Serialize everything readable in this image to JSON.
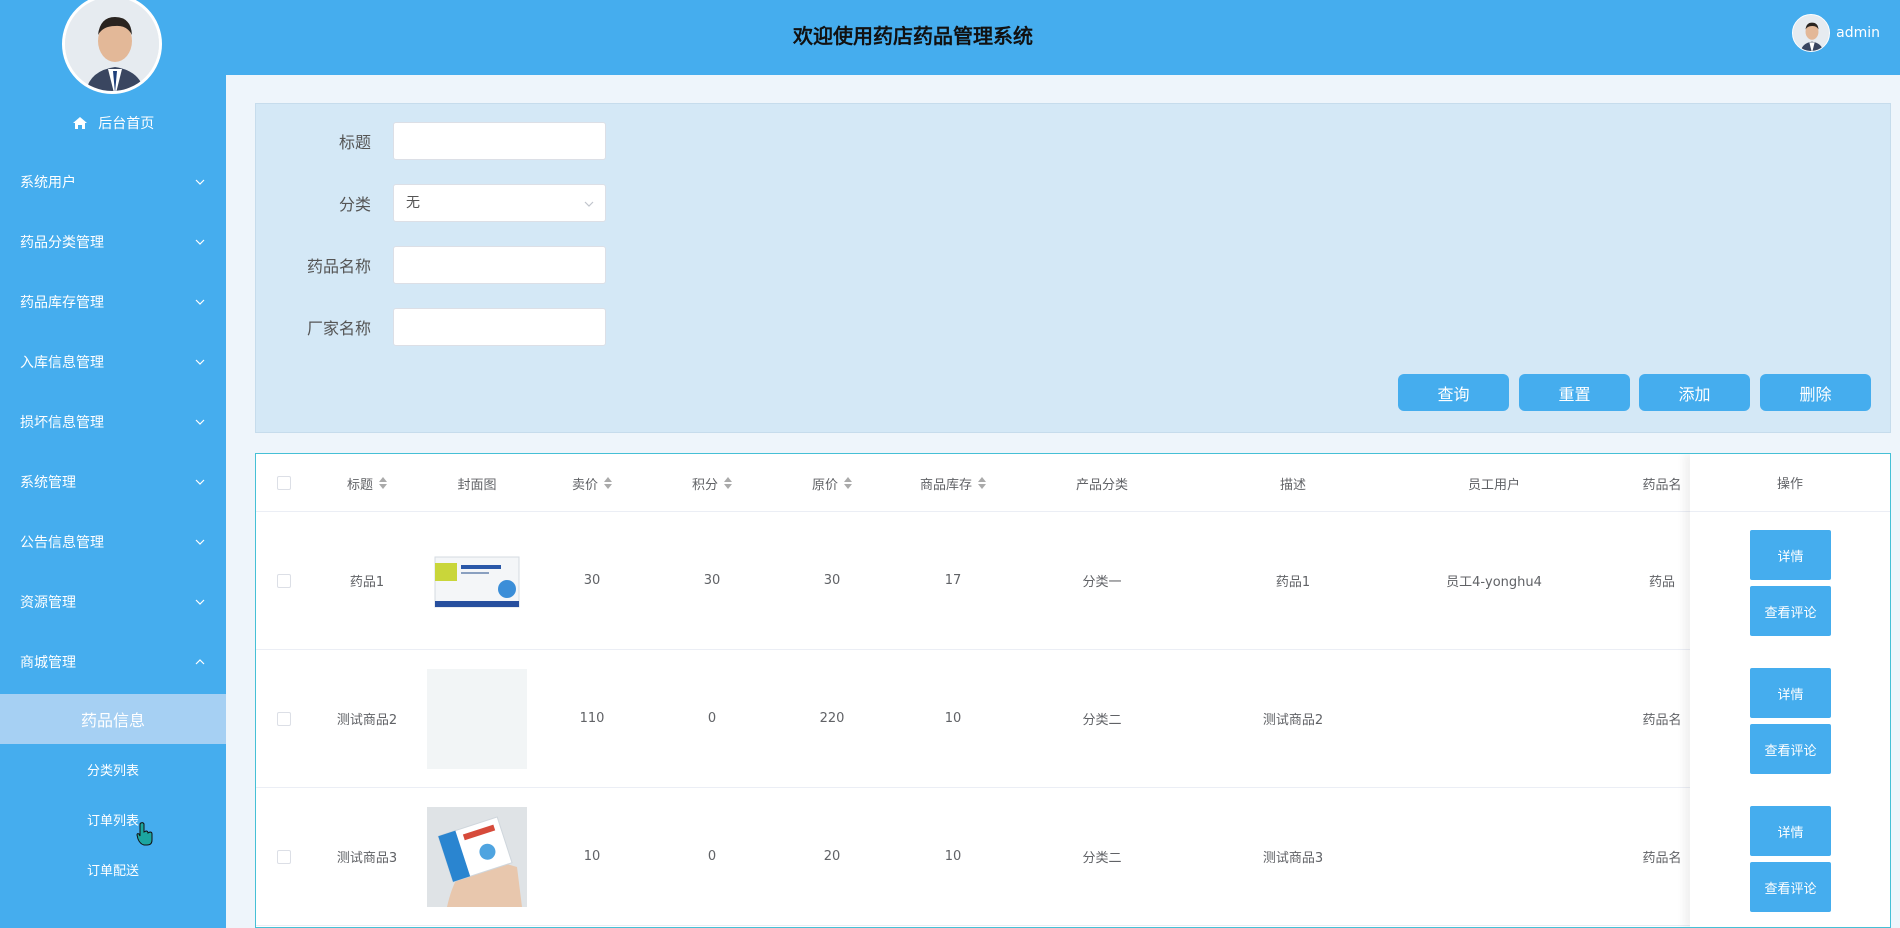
{
  "app": {
    "title": "欢迎使用药店药品管理系统"
  },
  "user": {
    "name": "admin"
  },
  "sidebar": {
    "home_label": "后台首页",
    "items": [
      {
        "label": "系统用户"
      },
      {
        "label": "药品分类管理"
      },
      {
        "label": "药品库存管理"
      },
      {
        "label": "入库信息管理"
      },
      {
        "label": "损坏信息管理"
      },
      {
        "label": "系统管理"
      },
      {
        "label": "公告信息管理"
      },
      {
        "label": "资源管理"
      },
      {
        "label": "商城管理"
      }
    ],
    "sub_items": [
      {
        "label": "药品信息"
      },
      {
        "label": "分类列表"
      },
      {
        "label": "订单列表"
      },
      {
        "label": "订单配送"
      }
    ]
  },
  "search": {
    "title_label": "标题",
    "title_value": "",
    "category_label": "分类",
    "category_value": "无",
    "drug_name_label": "药品名称",
    "drug_name_value": "",
    "manufacturer_label": "厂家名称",
    "manufacturer_value": ""
  },
  "buttons": {
    "query": "查询",
    "reset": "重置",
    "add": "添加",
    "delete": "删除"
  },
  "table": {
    "columns": [
      "标题",
      "封面图",
      "卖价",
      "积分",
      "原价",
      "商品库存",
      "产品分类",
      "描述",
      "员工用户",
      "药品名",
      "操作"
    ],
    "rows": [
      {
        "title": "药品1",
        "price": "30",
        "points": "30",
        "original_price": "30",
        "stock": "17",
        "category": "分类一",
        "description": "药品1",
        "staff": "员工4-yonghu4",
        "drug_name": "药品"
      },
      {
        "title": "测试商品2",
        "price": "110",
        "points": "0",
        "original_price": "220",
        "stock": "10",
        "category": "分类二",
        "description": "测试商品2",
        "staff": "",
        "drug_name": "药品名"
      },
      {
        "title": "测试商品3",
        "price": "10",
        "points": "0",
        "original_price": "20",
        "stock": "10",
        "category": "分类二",
        "description": "测试商品3",
        "staff": "",
        "drug_name": "药品名"
      }
    ],
    "row_actions": {
      "detail": "详情",
      "comments": "查看评论"
    }
  },
  "colors": {
    "primary": "#45adee",
    "active_sub": "#a6d0f3",
    "panel": "#d4e8f6"
  },
  "icons": {
    "home": "home-icon",
    "chevron_down": "chevron-down-icon",
    "chevron_up": "chevron-up-icon",
    "cursor": "hand-cursor-icon"
  }
}
